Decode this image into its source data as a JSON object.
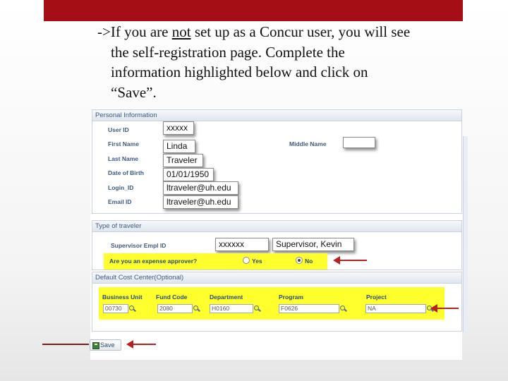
{
  "intro": {
    "prefix": "->If you are ",
    "emphasis": "not",
    "line1_rest": " set up as a Concur user, you will see",
    "line2": "the self-registration page.  Complete the",
    "line3": "information highlighted below and click on",
    "line4": "“Save”."
  },
  "personal": {
    "header": "Personal Information",
    "labels": {
      "user_id": "User ID",
      "first_name": "First Name",
      "last_name": "Last Name",
      "dob": "Date of Birth",
      "login_id": "Login_ID",
      "email_id": "Email ID",
      "middle_name": "Middle Name"
    },
    "values": {
      "user_id": "xxxxx",
      "first_name": "Linda",
      "last_name": "Traveler",
      "dob": "01/01/1950",
      "login_id": "ltraveler@uh.edu",
      "email_id": "ltraveler@uh.edu",
      "middle_name": ""
    }
  },
  "traveler": {
    "header": "Type of traveler",
    "supervisor_label": "Supervisor Empl ID",
    "supervisor_id": "xxxxxx",
    "supervisor_name": "Supervisor, Kevin",
    "approver_question": "Are you an expense approver?",
    "yes_label": "Yes",
    "no_label": "No",
    "approver_selected": "No"
  },
  "cost_center": {
    "header": "Default Cost Center(Optional)",
    "columns": [
      "Business Unit",
      "Fund Code",
      "Department",
      "Program",
      "Project"
    ],
    "values": [
      "00730",
      "2080",
      "H0160",
      "F0626",
      "NA"
    ]
  },
  "actions": {
    "save_label": "Save"
  },
  "colors": {
    "brand_bar": "#a50e14",
    "highlight": "#ffff2e",
    "arrow": "#b81f1f",
    "section_text": "#3d5a80"
  },
  "icons": [
    "lookup-icon",
    "save-icon",
    "red-arrow"
  ]
}
